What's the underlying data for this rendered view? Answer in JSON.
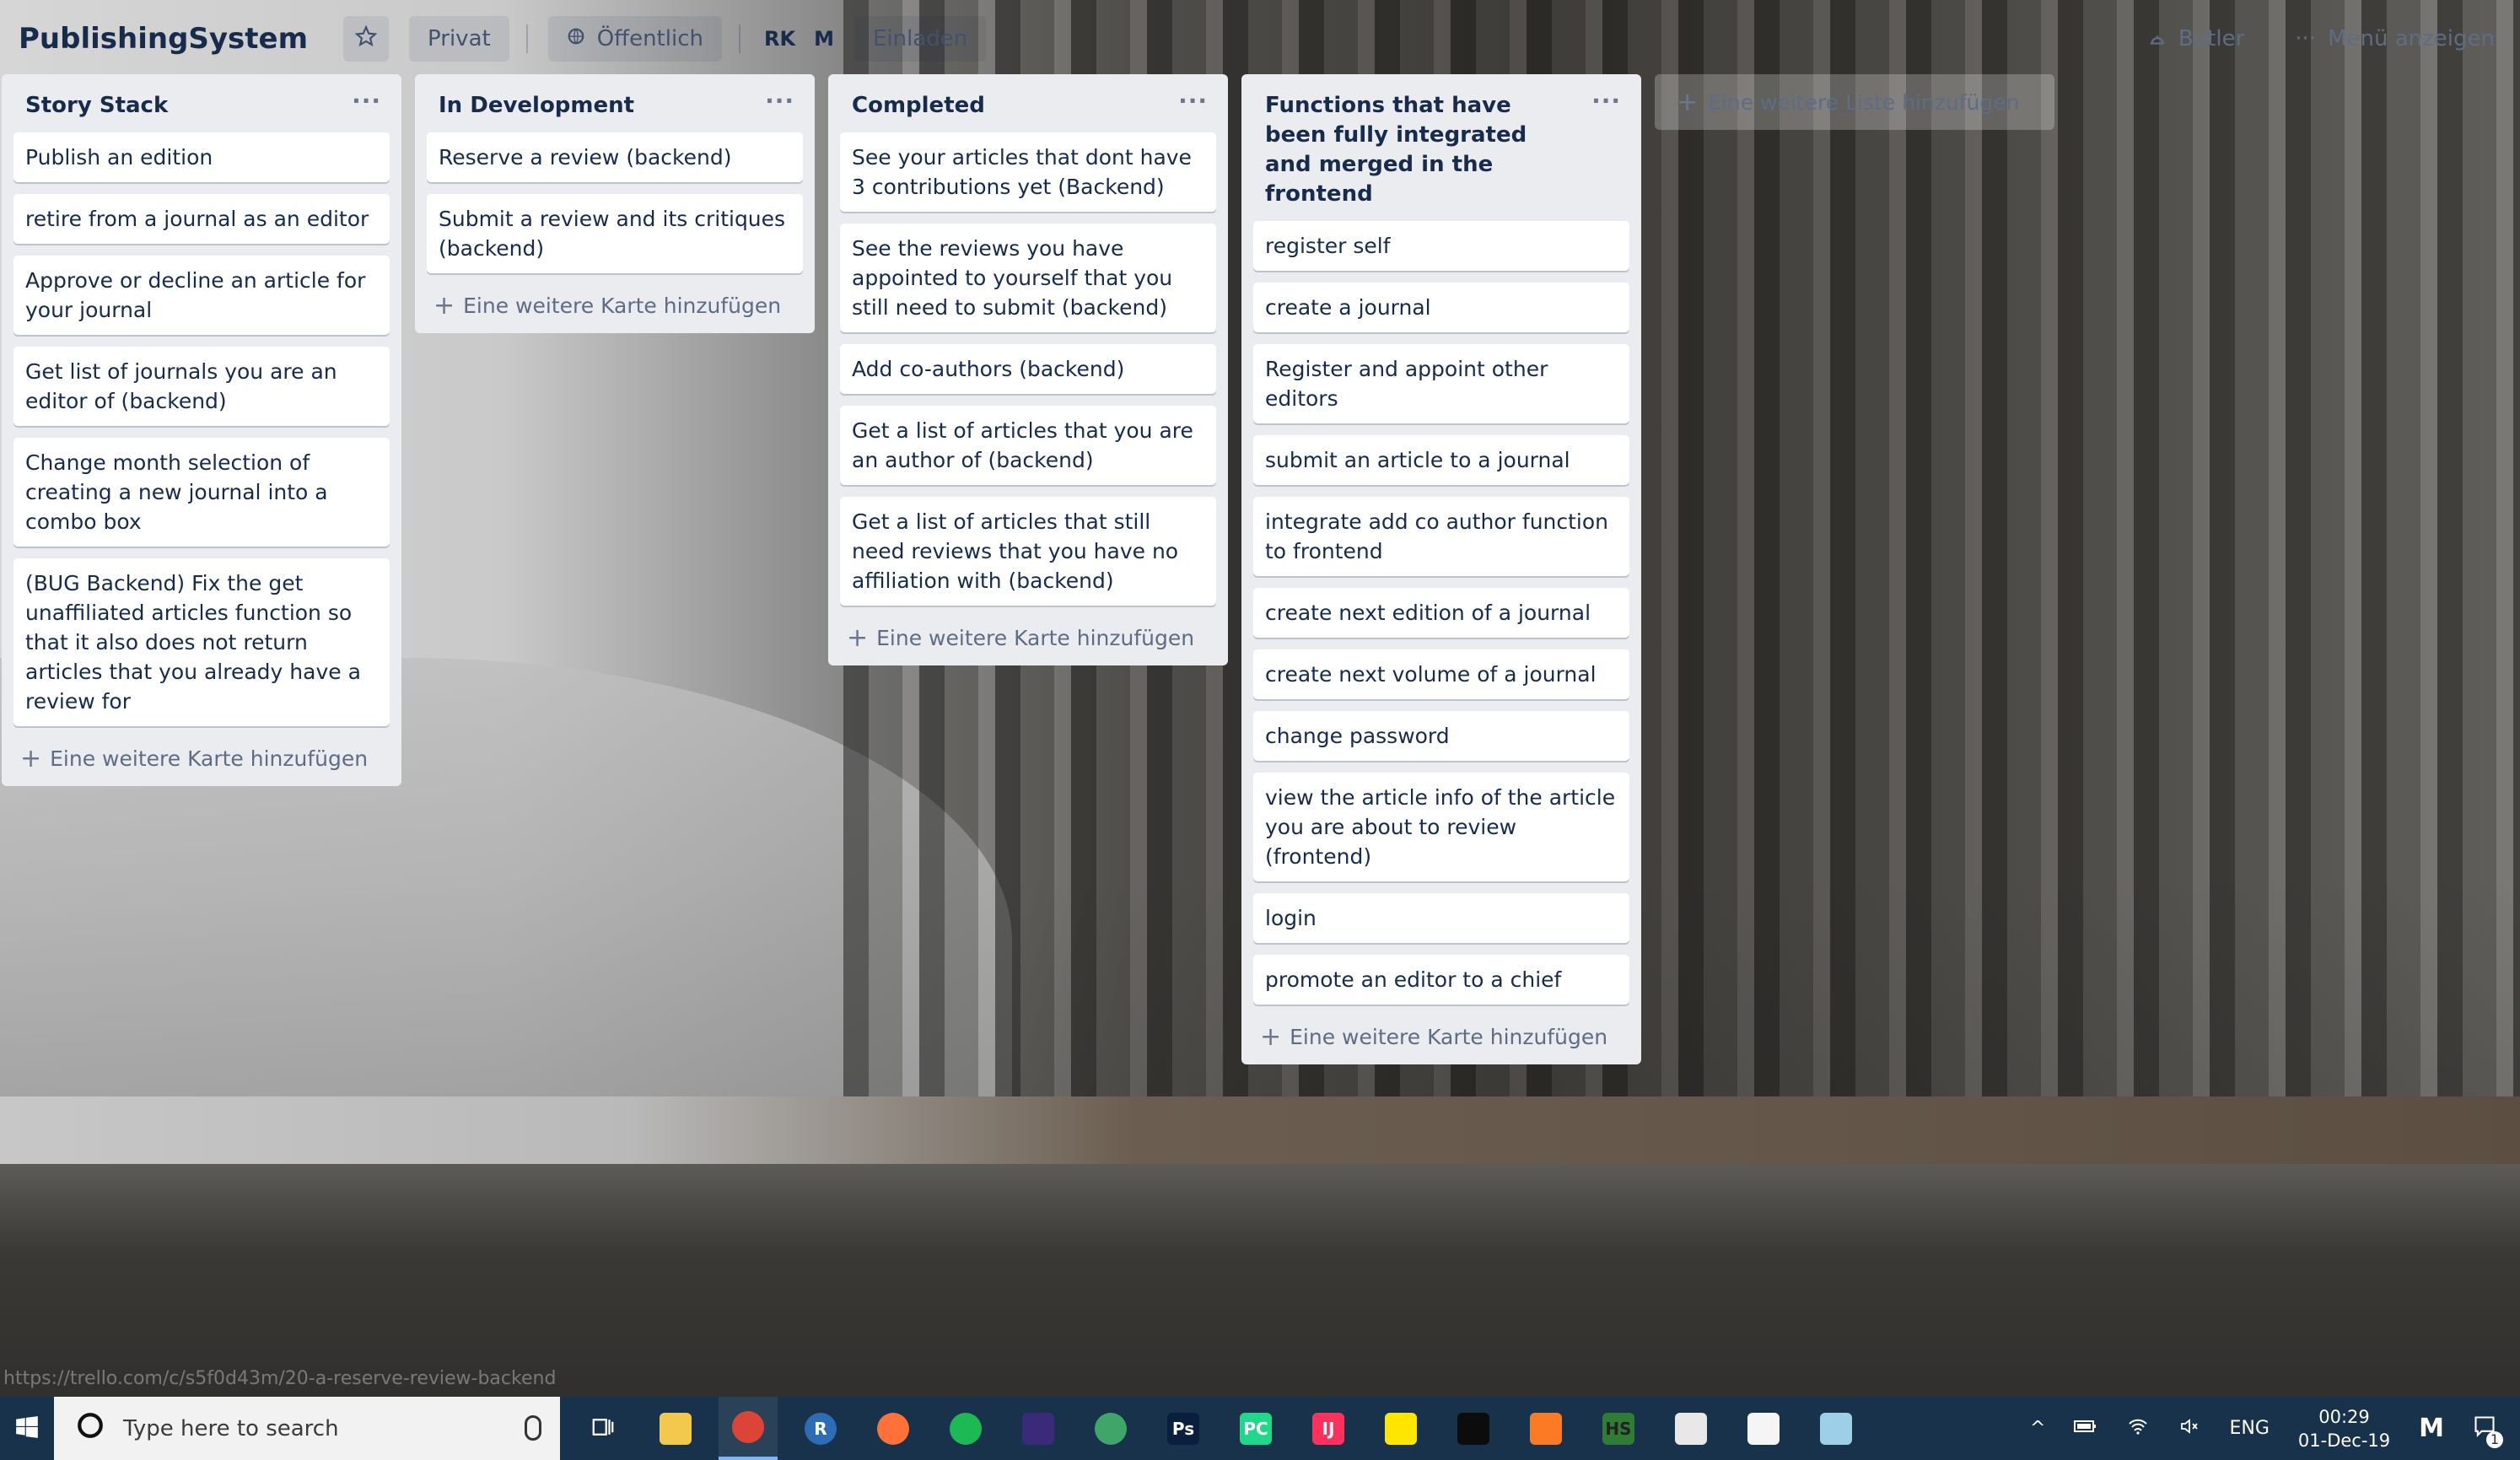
{
  "board": {
    "title": "PublishingSystem",
    "visibility_private": "Privat",
    "visibility_public": "Öffentlich",
    "members": [
      "RK",
      "M"
    ],
    "invite": "Einladen",
    "butler": "Butler",
    "show_menu": "Menü anzeigen"
  },
  "lists": [
    {
      "title": "Story Stack",
      "cards": [
        "Publish an edition",
        "retire from a journal as an editor",
        "Approve or decline an article for your journal",
        "Get list of journals you are an editor of (backend)",
        "Change month selection of creating a new journal into a combo box",
        "(BUG Backend) Fix the get unaffiliated articles function so that it also does not return articles that you already have a review for"
      ],
      "add_card": "Eine weitere Karte hinzufügen"
    },
    {
      "title": "In Development",
      "cards": [
        "Reserve a review (backend)",
        "Submit a review and its critiques (backend)"
      ],
      "add_card": "Eine weitere Karte hinzufügen"
    },
    {
      "title": "Completed",
      "cards": [
        "See your articles that dont have 3 contributions yet (Backend)",
        "See the reviews you have appointed to yourself that you still need to submit (backend)",
        "Add co-authors (backend)",
        "Get a list of articles that you are an author of (backend)",
        "Get a list of articles that still need reviews that you have no affiliation with (backend)"
      ],
      "add_card": "Eine weitere Karte hinzufügen"
    },
    {
      "title": "Functions that have been fully integrated and merged in the frontend",
      "cards": [
        "register self",
        "create a journal",
        "Register and appoint other editors",
        "submit an article to a journal",
        "integrate add co author function to frontend",
        "create next edition of a journal",
        "create next volume of a journal",
        "change password",
        "view the article info of the article you are about to review (frontend)",
        "login",
        "promote an editor to a chief"
      ],
      "add_card": "Eine weitere Karte hinzufügen"
    }
  ],
  "add_list": "Eine weitere Liste hinzufügen",
  "status_url": "https://trello.com/c/s5f0d43m/20-a-reserve-review-backend",
  "taskbar": {
    "search_placeholder": "Type here to search",
    "language": "ENG",
    "time": "00:29",
    "date": "01-Dec-19",
    "notification_count": "1",
    "apps": [
      {
        "name": "file-explorer-icon",
        "color": "#f2c94c",
        "label": ""
      },
      {
        "name": "chrome-icon",
        "color": "#db4437",
        "label": ""
      },
      {
        "name": "r-icon",
        "color": "#2d6db5",
        "label": "R"
      },
      {
        "name": "firefox-icon",
        "color": "#ff7139",
        "label": ""
      },
      {
        "name": "spotify-icon",
        "color": "#1db954",
        "label": ""
      },
      {
        "name": "eclipse-icon",
        "color": "#3b2a79",
        "label": ""
      },
      {
        "name": "globe-app-icon",
        "color": "#3fa66a",
        "label": ""
      },
      {
        "name": "photoshop-icon",
        "color": "#0a1e3d",
        "label": "Ps"
      },
      {
        "name": "pycharm-icon",
        "color": "#21d789",
        "label": "PC"
      },
      {
        "name": "intellij-icon",
        "color": "#fe315d",
        "label": "IJ"
      },
      {
        "name": "sticky-notes-icon",
        "color": "#ffe600",
        "label": ""
      },
      {
        "name": "terminal-icon",
        "color": "#0c0c0c",
        "label": ""
      },
      {
        "name": "xampp-icon",
        "color": "#fb7a24",
        "label": ""
      },
      {
        "name": "hs-app-icon",
        "color": "#2e7d32",
        "label": "HS"
      },
      {
        "name": "photos-icon",
        "color": "#e8e8e8",
        "label": ""
      },
      {
        "name": "java-icon",
        "color": "#f5f5f5",
        "label": ""
      },
      {
        "name": "app-window-icon",
        "color": "#9ecfe8",
        "label": ""
      }
    ]
  }
}
